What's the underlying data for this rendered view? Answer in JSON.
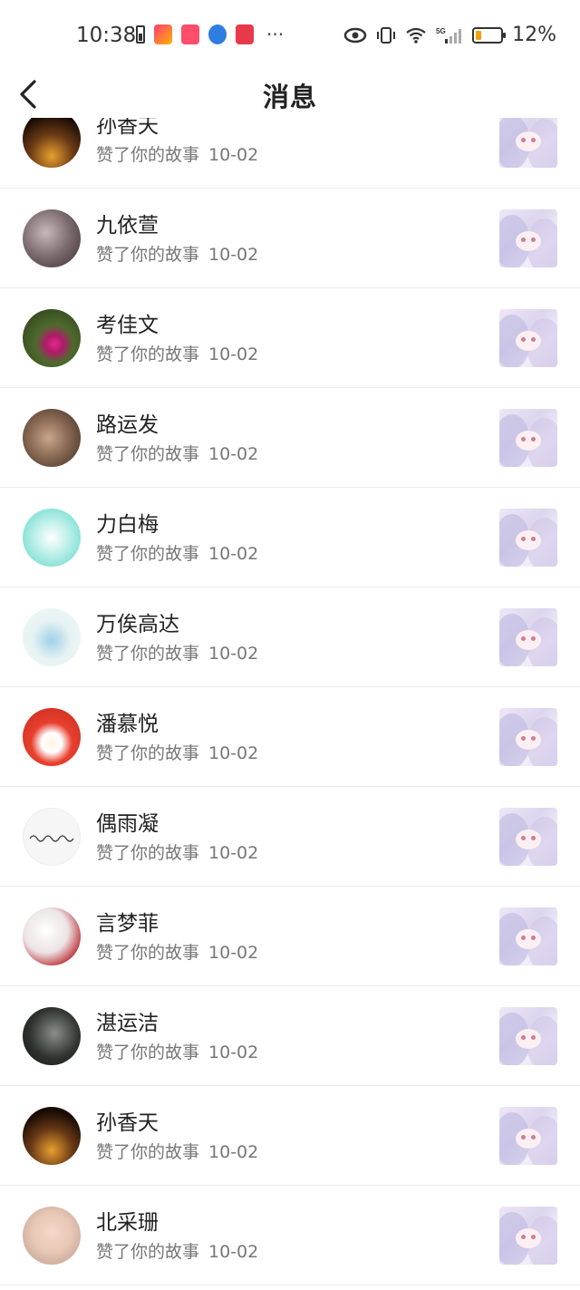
{
  "status_bar": {
    "time": "10:38",
    "battery_percent": "12%",
    "more_label": "···"
  },
  "header": {
    "title": "消息"
  },
  "messages": [
    {
      "name": "孙香天",
      "action": "赞了你的故事",
      "date": "10-02",
      "avatar_color": "#2b1a0f"
    },
    {
      "name": "九依萱",
      "action": "赞了你的故事",
      "date": "10-02",
      "avatar_color": "#7a6a6e"
    },
    {
      "name": "考佳文",
      "action": "赞了你的故事",
      "date": "10-02",
      "avatar_color": "#3c5a2a"
    },
    {
      "name": "路运发",
      "action": "赞了你的故事",
      "date": "10-02",
      "avatar_color": "#8a6a55"
    },
    {
      "name": "力白梅",
      "action": "赞了你的故事",
      "date": "10-02",
      "avatar_color": "#7fe0d6"
    },
    {
      "name": "万俟高达",
      "action": "赞了你的故事",
      "date": "10-02",
      "avatar_color": "#cfe7ec"
    },
    {
      "name": "潘慕悦",
      "action": "赞了你的故事",
      "date": "10-02",
      "avatar_color": "#e8402e"
    },
    {
      "name": "偶雨凝",
      "action": "赞了你的故事",
      "date": "10-02",
      "avatar_color": "#f5f5f5"
    },
    {
      "name": "言梦菲",
      "action": "赞了你的故事",
      "date": "10-02",
      "avatar_color": "#e9dfe0"
    },
    {
      "name": "湛运洁",
      "action": "赞了你的故事",
      "date": "10-02",
      "avatar_color": "#2f3330"
    },
    {
      "name": "孙香天",
      "action": "赞了你的故事",
      "date": "10-02",
      "avatar_color": "#2b1a0f"
    },
    {
      "name": "北采珊",
      "action": "赞了你的故事",
      "date": "10-02",
      "avatar_color": "#e8c7b5"
    }
  ]
}
